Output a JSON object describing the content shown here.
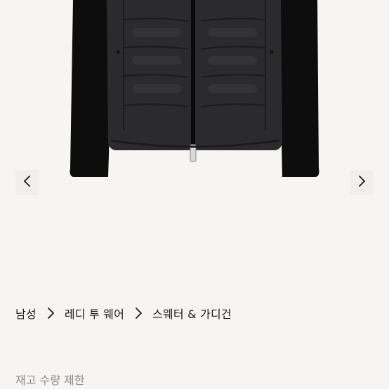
{
  "product": {
    "image_alt": "black quilted down jacket with knit sleeves"
  },
  "carousel": {
    "prev_icon": "chevron-left-icon",
    "next_icon": "chevron-right-icon"
  },
  "breadcrumb": {
    "items": [
      "남성",
      "레디 투 웨어",
      "스웨터 & 가디건"
    ],
    "separator_icon": "chevron-right-icon"
  },
  "stock_note": "재고 수량 제한",
  "colors": {
    "background": "#f6f5f2",
    "text": "#1a1a1a",
    "muted_text": "#8a8a8a",
    "jacket": "#2b2b2d",
    "sleeve": "#0d0d0d"
  }
}
